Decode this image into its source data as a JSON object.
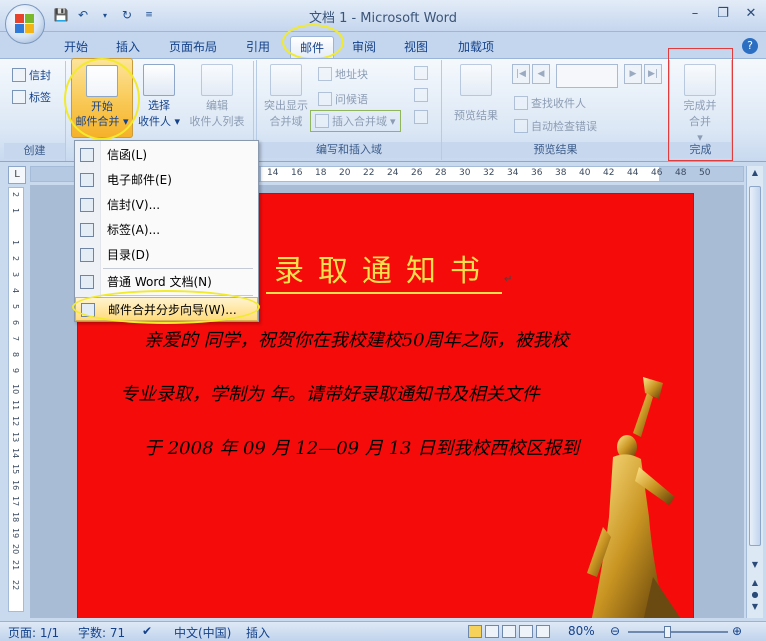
{
  "window": {
    "title": "文档 1 - Microsoft Word",
    "controls": [
      "minimize",
      "restore",
      "close"
    ]
  },
  "qat": {
    "icons": [
      "save-icon",
      "undo-icon",
      "redo-icon",
      "customize-icon"
    ]
  },
  "tabs": [
    {
      "label": "开始"
    },
    {
      "label": "插入"
    },
    {
      "label": "页面布局"
    },
    {
      "label": "引用"
    },
    {
      "label": "邮件",
      "active": true
    },
    {
      "label": "审阅"
    },
    {
      "label": "视图"
    },
    {
      "label": "加载项"
    }
  ],
  "ribbon": {
    "groups": {
      "create": {
        "label": "创建",
        "envelope": "信封",
        "labels": "标签"
      },
      "start_merge": {
        "start_label_1": "开始",
        "start_label_2": "邮件合并",
        "select_label_1": "选择",
        "select_label_2": "收件人",
        "edit_label_1": "编辑",
        "edit_label_2": "收件人列表"
      },
      "write_insert": {
        "label": "编写和插入域",
        "highlight_1": "突出显示",
        "highlight_2": "合并域",
        "address_block": "地址块",
        "greeting": "问候语",
        "insert_merge_field": "插入合并域"
      },
      "preview": {
        "label": "预览结果",
        "preview_results": "预览结果",
        "find_recipient": "查找收件人",
        "auto_check": "自动检查错误"
      },
      "finish": {
        "label": "完成",
        "finish_label_1": "完成并",
        "finish_label_2": "合并"
      }
    }
  },
  "menu": {
    "items": [
      {
        "label": "信函(L)"
      },
      {
        "label": "电子邮件(E)"
      },
      {
        "label": "信封(V)..."
      },
      {
        "label": "标签(A)..."
      },
      {
        "label": "目录(D)"
      },
      {
        "label": "普通 Word 文档(N)"
      },
      {
        "label": "邮件合并分步向导(W)..."
      }
    ]
  },
  "ruler": {
    "ticks": [
      "14",
      "16",
      "18",
      "20",
      "22",
      "24",
      "26",
      "28",
      "30",
      "32",
      "34",
      "36",
      "38",
      "40",
      "42",
      "44",
      "46",
      "48",
      "50"
    ],
    "vticks": [
      "2",
      "1",
      "1",
      "2",
      "3",
      "4",
      "5",
      "6",
      "7",
      "8",
      "9",
      "10",
      "11",
      "12",
      "13",
      "14",
      "15",
      "16",
      "17",
      "18",
      "19",
      "20",
      "21",
      "22"
    ]
  },
  "document": {
    "title": "录取通知书",
    "line1": "亲爱的    同学，祝贺你在我校建校50周年之际，被我校",
    "line2": "专业录取，学制为   年。请带好录取通知书及相关文件",
    "line3": "于 2008 年 09 月 12—09 月 13 日到我校西校区报到"
  },
  "status": {
    "page": "页面: 1/1",
    "words": "字数: 71",
    "language": "中文(中国)",
    "mode": "插入",
    "zoom": "80%"
  },
  "colors": {
    "page_bg": "#f60b0b",
    "title_color": "#f8df4c",
    "highlight_circle": "#f2ea2c",
    "red_box": "#e23b3b"
  }
}
